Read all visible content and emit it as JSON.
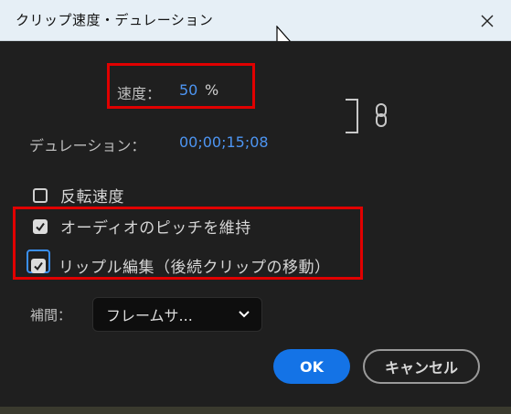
{
  "window": {
    "title": "クリップ速度・デュレーション"
  },
  "speed": {
    "label": "速度：",
    "value": "50",
    "unit": "%"
  },
  "duration": {
    "label": "デュレーション：",
    "value": "00;00;15;08"
  },
  "options": {
    "reverse": {
      "label": "反転速度",
      "checked": false
    },
    "maintain_pitch": {
      "label": "オーディオのピッチを維持",
      "checked": true
    },
    "ripple_edit": {
      "label": "リップル編集（後続クリップの移動）",
      "checked": true
    }
  },
  "interpolation": {
    "label": "補間：",
    "selected": "フレームサ..."
  },
  "buttons": {
    "ok": "OK",
    "cancel": "キャンセル"
  },
  "colors": {
    "accent": "#1473e6",
    "value_blue": "#4d95f2",
    "highlight_red": "#e00000"
  },
  "icons": [
    "close-icon",
    "link-icon",
    "chevron-down-icon",
    "check-icon",
    "mouse-cursor-icon"
  ]
}
